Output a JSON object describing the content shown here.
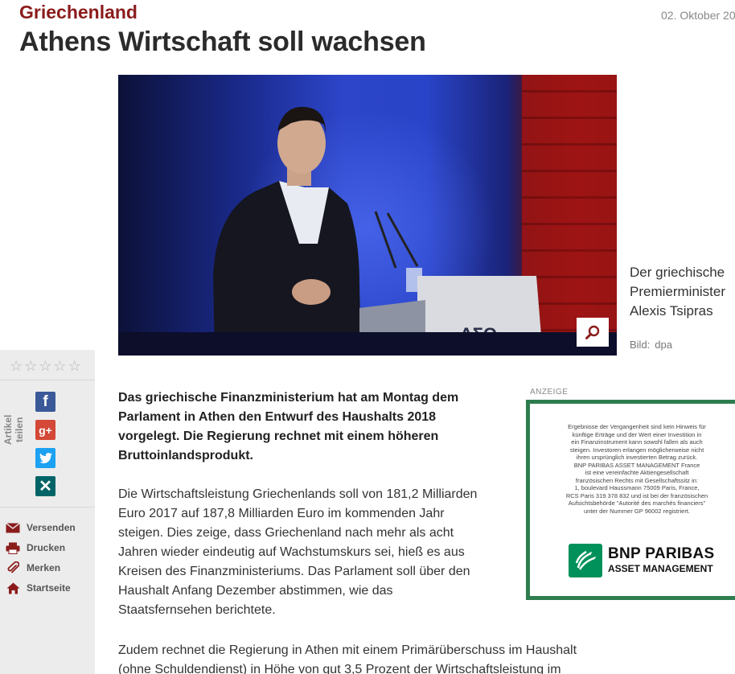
{
  "article": {
    "category": "Griechenland",
    "date": "02. Oktober 20",
    "headline": "Athens Wirtschaft soll wachsen",
    "image": {
      "caption_lines": [
        "Der griechische",
        "Premierminister",
        "Alexis Tsipras"
      ],
      "credit_label": "Bild:",
      "credit_value": "dpa",
      "zoom_icon": "search-icon"
    },
    "lead_lines": [
      "Das griechische Finanzministerium hat am Montag dem",
      "Parlament in Athen den Entwurf des Haushalts 2018",
      "vorgelegt. Die Regierung rechnet mit einem höheren",
      "Bruttoinlandsprodukt."
    ],
    "paragraph1_lines": [
      "Die Wirtschaftsleistung Griechenlands soll von 181,2 Milliarden",
      "Euro 2017 auf 187,8 Milliarden Euro im kommenden Jahr",
      "steigen. Dies zeige, dass Griechenland nach mehr als acht",
      "Jahren wieder eindeutig auf Wachstumskurs sei, hieß es aus",
      "Kreisen des Finanzministeriums. Das Parlament soll über den",
      "Haushalt Anfang Dezember abstimmen, wie das",
      "Staatsfernsehen berichtete."
    ],
    "paragraph2_lines": [
      "Zudem rechnet die Regierung in Athen mit einem Primärüberschuss im Haushalt",
      "(ohne Schuldendienst) in Höhe von gut 3,5 Prozent der Wirtschaftsleistung im"
    ]
  },
  "sidebar": {
    "rating_stars": [
      "☆",
      "☆",
      "☆",
      "☆",
      "☆"
    ],
    "share_label": "Artikel teilen",
    "social": [
      {
        "name": "facebook",
        "glyph": "f",
        "color": "#3b5998"
      },
      {
        "name": "google-plus",
        "glyph": "g+",
        "color": "#d34836"
      },
      {
        "name": "twitter",
        "glyph": "🐦",
        "color": "#1da1f2"
      },
      {
        "name": "xing",
        "glyph": "✕",
        "color": "#026466"
      }
    ],
    "actions": [
      {
        "label": "Versenden",
        "icon": "envelope-icon"
      },
      {
        "label": "Drucken",
        "icon": "printer-icon"
      },
      {
        "label": "Merken",
        "icon": "paperclip-icon"
      },
      {
        "label": "Startseite",
        "icon": "home-icon"
      }
    ]
  },
  "ad": {
    "label": "ANZEIGE",
    "disclaimer_lines": [
      "Ergebnisse der Vergangenheit sind kein Hinweis für",
      "künftige Erträge und der Wert einer Investition in",
      "ein Finanzinstrument kann sowohl fallen als auch",
      "steigen. Investoren erlangen möglicherweise nicht",
      "ihren ursprünglich investierten Betrag zurück.",
      "BNP PARIBAS ASSET MANAGEMENT France",
      "ist eine vereinfachte Aktiengesellschaft",
      "französischen Rechts mit Gesellschaftssitz in:",
      "1, boulevard Haussmann 75009 Paris, France,",
      "RCS Paris 319 378 832 und ist bei der französischen",
      "Aufsichtsbehörde \"Autorité des marchés financiers\"",
      "unter der Nummer GP 96002 registriert."
    ],
    "brand_name": "BNP PARIBAS",
    "brand_sub": "ASSET MANAGEMENT",
    "brand_color": "#00915a"
  }
}
